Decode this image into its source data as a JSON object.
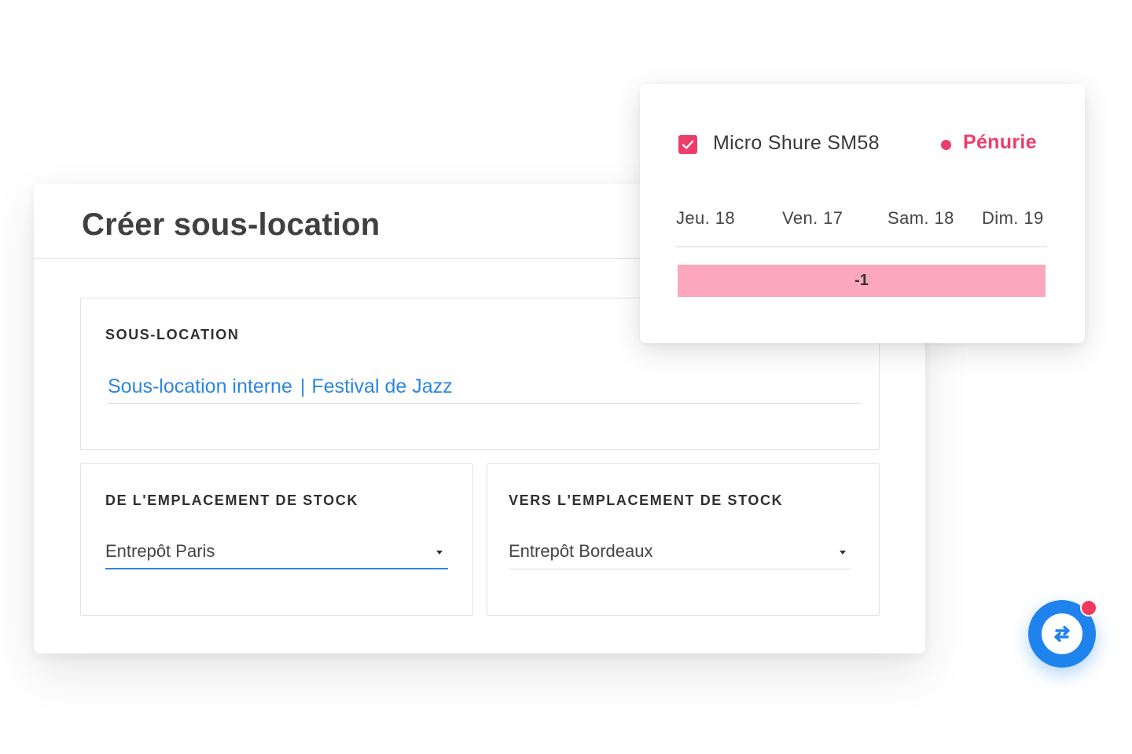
{
  "form": {
    "title": "Créer sous-location",
    "sublocation": {
      "label": "SOUS-LOCATION",
      "type": "Sous-location interne",
      "separator": "|",
      "event": "Festival de Jazz"
    },
    "from_stock": {
      "label": "DE L'EMPLACEMENT DE STOCK",
      "value": "Entrepôt Paris"
    },
    "to_stock": {
      "label": "VERS L'EMPLACEMENT DE STOCK",
      "value": "Entrepôt Bordeaux"
    }
  },
  "availability": {
    "product": "Micro Shure SM58",
    "checked": true,
    "status": "Pénurie",
    "days": [
      "Jeu. 18",
      "Ven. 17",
      "Sam. 18",
      "Dim. 19"
    ],
    "shortage": "-1"
  },
  "colors": {
    "accent_blue": "#2d86e0",
    "shortage_pink": "#ee3d6a",
    "shortage_bar": "#fca7bd",
    "fab_blue": "#1f83ee"
  },
  "icons": {
    "checkbox": "check-icon",
    "fab": "swap-arrows-icon",
    "caret": "chevron-down-icon"
  }
}
